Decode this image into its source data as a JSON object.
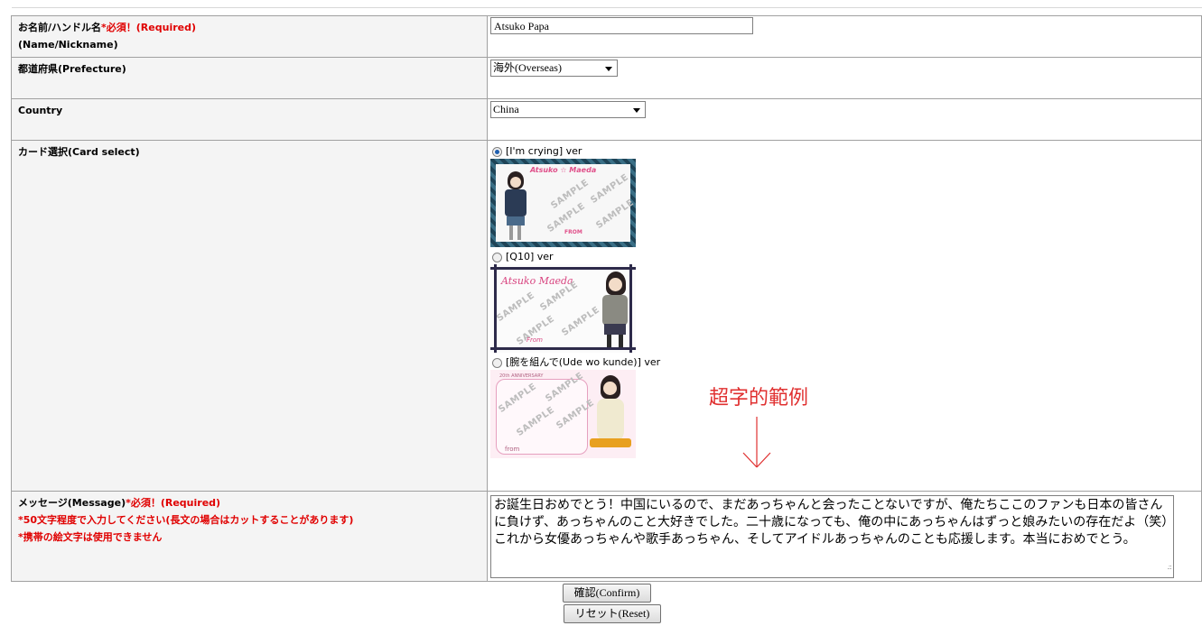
{
  "form": {
    "name_label": "お名前/ハンドル名",
    "name_required": "*必須！(Required)",
    "name_label_en": "(Name/Nickname)",
    "name_value": "Atsuko Papa",
    "prefecture_label": "都道府県(Prefecture)",
    "prefecture_value": "海外(Overseas)",
    "country_label": "Country",
    "country_value": "China",
    "card_label": "カード選択(Card select)",
    "cards": [
      {
        "label": "[I'm crying] ver",
        "selected": true
      },
      {
        "label": "[Q10] ver",
        "selected": false
      },
      {
        "label": "[腕を組んで(Ude wo kunde)] ver",
        "selected": false
      }
    ],
    "message_label": "メッセージ(Message)",
    "message_required": "*必須！(Required)",
    "message_note1": "*50文字程度で入力してください(長文の場合はカットすることがあります)",
    "message_note2": "*携帯の絵文字は使用できません",
    "message_value": "お誕生日おめでとう！中国にいるので、まだあっちゃんと会ったことないですが、俺たちここのファンも日本の皆さんに負けず、あっちゃんのこと大好きでした。二十歳になっても、俺の中にあっちゃんはずっと娘みたいの存在だよ（笑）これから女優あっちゃんや歌手あっちゃん、そしてアイドルあっちゃんのことも応援します。本当におめでとう。"
  },
  "card_art": {
    "sample_text": "SAMPLE",
    "card1_title": "Atsuko ☆ Maeda",
    "card1_from": "FROM",
    "card2_title": "Atsuko Maeda",
    "card2_from": "From",
    "card3_header": "20th ANNIVERSARY",
    "card3_from": "from"
  },
  "annotation": {
    "text": "超字的範例"
  },
  "buttons": {
    "confirm": "確認(Confirm)",
    "reset": "リセット(Reset)"
  },
  "colors": {
    "required_red": "#e00000",
    "annotation_red": "#e03030",
    "label_bg": "#f4f4f4"
  }
}
